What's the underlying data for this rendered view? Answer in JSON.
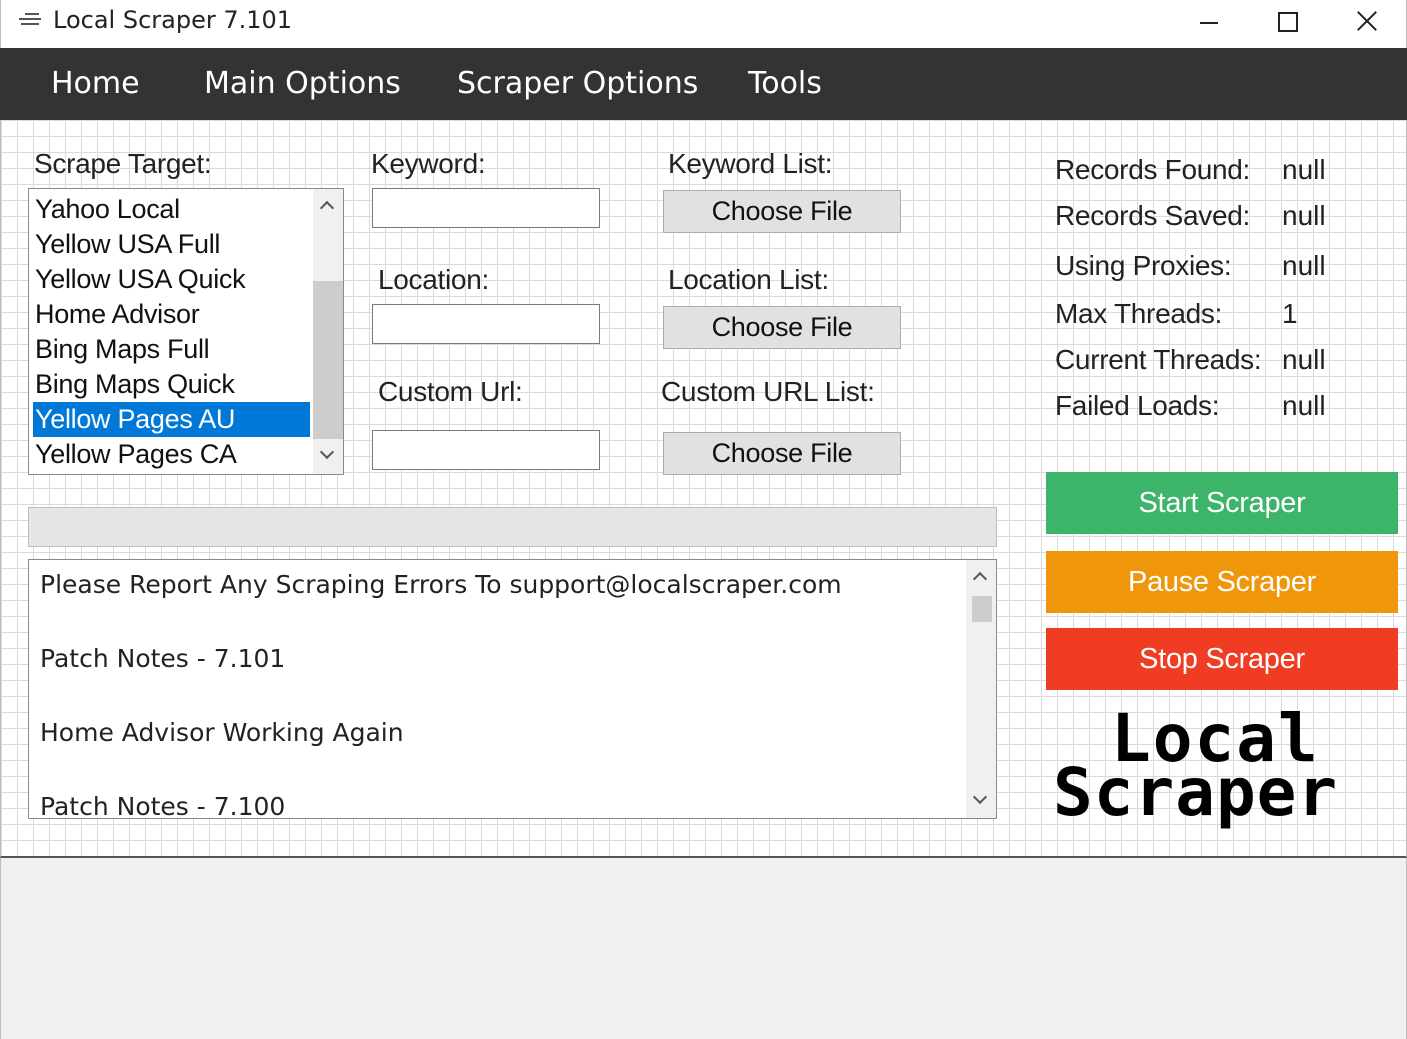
{
  "window": {
    "title": "Local Scraper 7.101"
  },
  "menu": {
    "items": [
      {
        "label": "Home"
      },
      {
        "label": "Main Options"
      },
      {
        "label": "Scraper Options"
      },
      {
        "label": "Tools"
      }
    ]
  },
  "form": {
    "scrape_target_label": "Scrape Target:",
    "keyword_label": "Keyword:",
    "keyword_value": "",
    "location_label": "Location:",
    "location_value": "",
    "custom_url_label": "Custom Url:",
    "custom_url_value": "",
    "keyword_list_label": "Keyword List:",
    "location_list_label": "Location List:",
    "custom_url_list_label": "Custom URL List:",
    "choose_file_label": "Choose File"
  },
  "scrape_targets": {
    "items": [
      {
        "label": "Yahoo Local"
      },
      {
        "label": "Yellow USA Full"
      },
      {
        "label": "Yellow USA Quick"
      },
      {
        "label": "Home Advisor"
      },
      {
        "label": "Bing Maps Full"
      },
      {
        "label": "Bing Maps Quick"
      },
      {
        "label": "Yellow Pages AU",
        "selected": true
      },
      {
        "label": "Yellow Pages CA"
      }
    ]
  },
  "stats": {
    "records_found_label": "Records Found:",
    "records_found_value": "null",
    "records_saved_label": "Records Saved:",
    "records_saved_value": "null",
    "using_proxies_label": "Using Proxies:",
    "using_proxies_value": "null",
    "max_threads_label": "Max Threads:",
    "max_threads_value": "1",
    "current_threads_label": "Current Threads:",
    "current_threads_value": "null",
    "failed_loads_label": "Failed Loads:",
    "failed_loads_value": "null"
  },
  "progress": {
    "value": 0
  },
  "log": {
    "lines": [
      "Please Report Any Scraping Errors To support@localscraper.com",
      "Patch Notes - 7.101",
      "Home Advisor Working Again",
      "Patch Notes - 7.100"
    ]
  },
  "actions": {
    "start_label": "Start Scraper",
    "pause_label": "Pause Scraper",
    "stop_label": "Stop Scraper"
  },
  "logo": {
    "line1": "Local",
    "line2": "Scraper"
  },
  "colors": {
    "menubar": "#333333",
    "selection": "#0078d7",
    "start": "#3cb469",
    "pause": "#f0960a",
    "stop": "#f03c23"
  }
}
